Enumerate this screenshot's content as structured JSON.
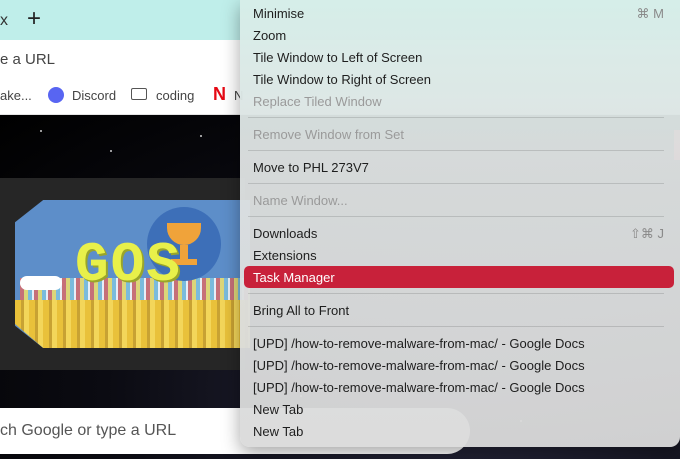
{
  "browser": {
    "new_tab_label": "+",
    "tab_close_glyph": "x",
    "omnibox_text": "e a URL",
    "bookmarks": [
      {
        "label": "ake...",
        "icon": "none"
      },
      {
        "label": "Discord",
        "icon": "discord-icon"
      },
      {
        "label": "coding",
        "icon": "folder-icon"
      },
      {
        "label": "N",
        "icon": "netflix-icon"
      }
    ],
    "netflix_glyph": "N",
    "searchbox_text": "ch Google or type a URL",
    "doodle_text": "GOS"
  },
  "menu": {
    "items": [
      {
        "label": "Minimise",
        "shortcut": "⌘ M",
        "enabled": true
      },
      {
        "label": "Zoom",
        "shortcut": "",
        "enabled": true
      },
      {
        "label": "Tile Window to Left of Screen",
        "shortcut": "",
        "enabled": true
      },
      {
        "label": "Tile Window to Right of Screen",
        "shortcut": "",
        "enabled": true
      },
      {
        "label": "Replace Tiled Window",
        "shortcut": "",
        "enabled": false
      },
      {
        "label": "Remove Window from Set",
        "shortcut": "",
        "enabled": false
      },
      {
        "label": "Move to PHL 273V7",
        "shortcut": "",
        "enabled": true
      },
      {
        "label": "Name Window...",
        "shortcut": "",
        "enabled": false
      },
      {
        "label": "Downloads",
        "shortcut": "⇧⌘ J",
        "enabled": true
      },
      {
        "label": "Extensions",
        "shortcut": "",
        "enabled": true
      },
      {
        "label": "Task Manager",
        "shortcut": "",
        "enabled": true,
        "highlighted": true
      },
      {
        "label": "Bring All to Front",
        "shortcut": "",
        "enabled": true
      },
      {
        "label": "[UPD] /how-to-remove-malware-from-mac/ - Google Docs",
        "shortcut": "",
        "enabled": true
      },
      {
        "label": "[UPD] /how-to-remove-malware-from-mac/ - Google Docs",
        "shortcut": "",
        "enabled": true
      },
      {
        "label": "[UPD] /how-to-remove-malware-from-mac/ - Google Docs",
        "shortcut": "",
        "enabled": true
      },
      {
        "label": "New Tab",
        "shortcut": "",
        "enabled": true
      },
      {
        "label": "New Tab",
        "shortcut": "",
        "enabled": true
      }
    ]
  },
  "colors": {
    "highlight": "#c8213a",
    "tabstrip": "#bfeeea",
    "doodle_sky": "#5d8ec9",
    "doodle_letters": "#e8f04a"
  }
}
